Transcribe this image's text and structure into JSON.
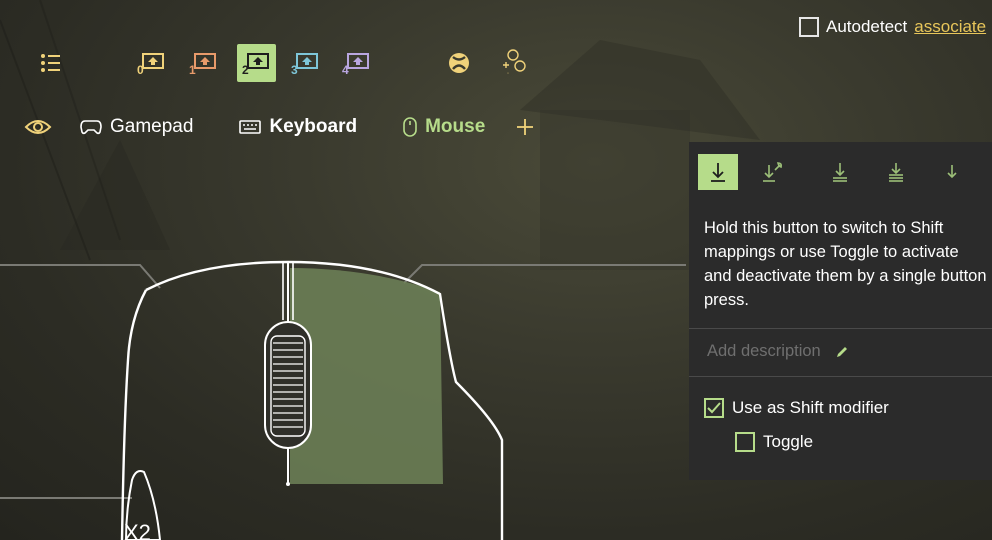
{
  "autodetect": {
    "label": "Autodetect",
    "link": "associate",
    "checked": false
  },
  "toolbar": {
    "menu_icon": "list-icon",
    "shift_layers": [
      "0",
      "1",
      "2",
      "3",
      "4"
    ],
    "active_layer": "2",
    "xbox_icon": "xbox-icon",
    "buttons_icon": "abxy-buttons-icon"
  },
  "tabs": [
    {
      "label": "Gamepad",
      "icon": "gamepad-icon"
    },
    {
      "label": "Keyboard",
      "icon": "keyboard-icon"
    },
    {
      "label": "Mouse",
      "icon": "mouse-icon",
      "active": true
    }
  ],
  "panel": {
    "modes": [
      "hold-down-icon",
      "wrench-down-icon",
      "double-down-icon",
      "triple-down-icon",
      "arrow-down-icon"
    ],
    "description": "Hold this button to switch to Shift mappings or use Toggle to activate and deactivate them by a single button press.",
    "add_description_placeholder": "Add description",
    "use_shift_label": "Use as Shift modifier",
    "use_shift_checked": true,
    "toggle_label": "Toggle",
    "toggle_checked": false
  },
  "mouse": {
    "side_button_label": "X2"
  },
  "colors": {
    "accent": "#b6dc8a",
    "link": "#e8c65a",
    "panel": "#2b2b2b"
  }
}
